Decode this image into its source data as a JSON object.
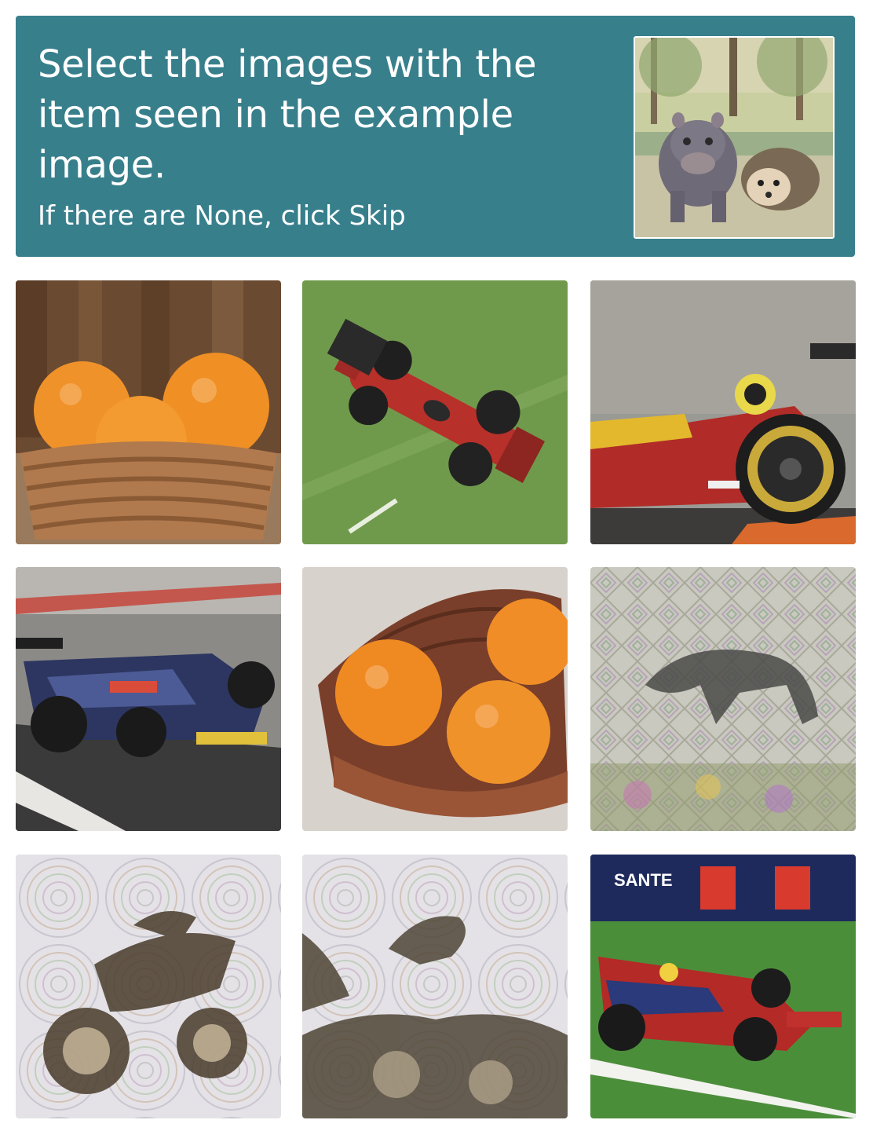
{
  "challenge": {
    "prompt": "Select the images with the item seen in the example image.",
    "subprompt": "If there are None, click Skip",
    "example_image": "hippo-and-hedgehog-example-image",
    "accent_color": "#387f8c"
  },
  "tiles": [
    {
      "content": "oranges-in-basket"
    },
    {
      "content": "red-race-car-on-grass"
    },
    {
      "content": "red-race-car-closeup"
    },
    {
      "content": "blue-race-car-on-track"
    },
    {
      "content": "oranges-in-basket-angled"
    },
    {
      "content": "blurred-animal-pattern"
    },
    {
      "content": "blurred-motorcycle-pattern"
    },
    {
      "content": "blurred-animal-circles-pattern"
    },
    {
      "content": "red-race-car-on-grass-banner"
    }
  ],
  "tile_texts": {
    "banner_text": "SANTE"
  }
}
